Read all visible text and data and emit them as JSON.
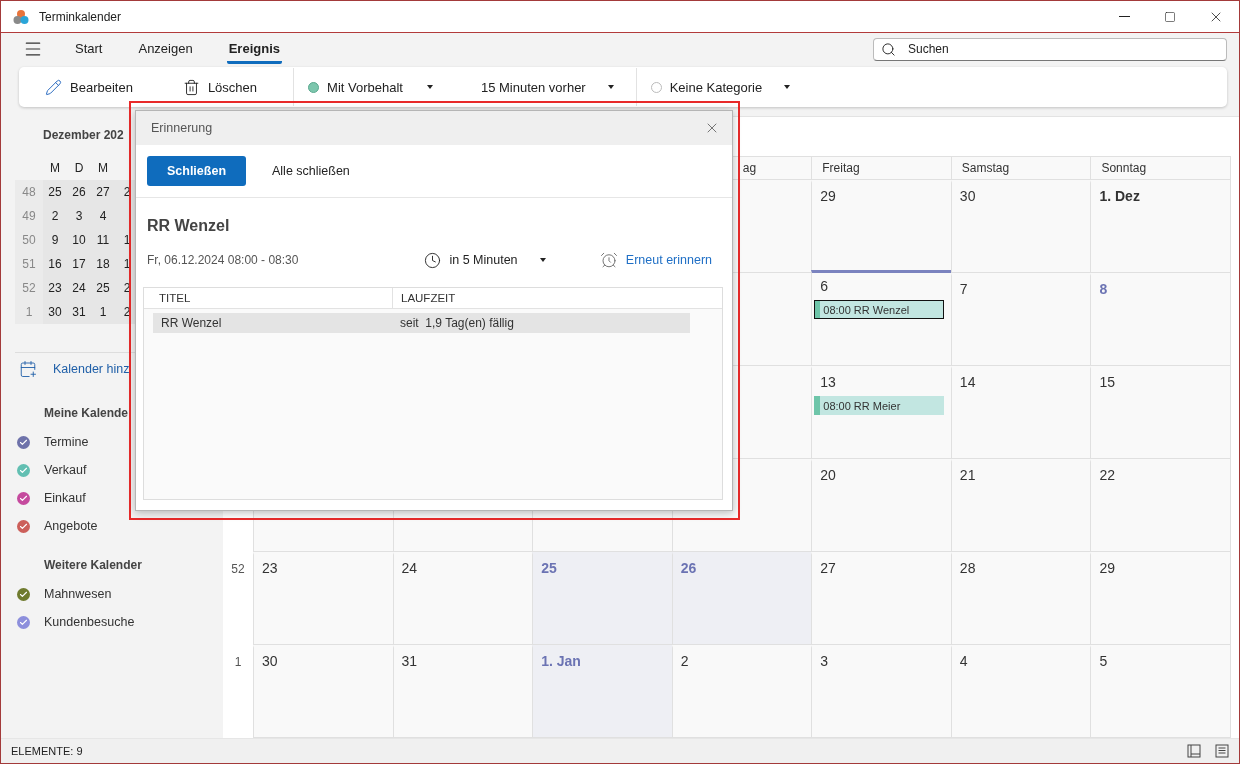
{
  "window": {
    "title": "Terminkalender"
  },
  "menu_tabs": [
    {
      "label": "Start",
      "selected": false
    },
    {
      "label": "Anzeigen",
      "selected": false
    },
    {
      "label": "Ereignis",
      "selected": true
    }
  ],
  "search": {
    "placeholder": "Suchen"
  },
  "toolbar": {
    "edit": "Bearbeiten",
    "delete": "Löschen",
    "availability": "Mit Vorbehalt",
    "reminder": "15 Minuten vorher",
    "category": "Keine Kategorie"
  },
  "mini_calendar": {
    "title": "Dezember 202",
    "weekdays": [
      "M",
      "D",
      "M"
    ],
    "weeks": [
      {
        "number": "48",
        "days": [
          "25",
          "26",
          "27",
          "2"
        ]
      },
      {
        "number": "49",
        "days": [
          "2",
          "3",
          "4"
        ]
      },
      {
        "number": "50",
        "days": [
          "9",
          "10",
          "11",
          "1"
        ]
      },
      {
        "number": "51",
        "days": [
          "16",
          "17",
          "18",
          "1"
        ]
      },
      {
        "number": "52",
        "days": [
          "23",
          "24",
          "25",
          "2"
        ]
      },
      {
        "number": "1",
        "days": [
          "30",
          "31",
          "1",
          "2"
        ]
      }
    ]
  },
  "add_calendar": "Kalender hinz",
  "calendar_groups": [
    {
      "title": "Meine Kalende",
      "calendars": [
        {
          "name": "Termine",
          "color": "#6e72aa",
          "checked": true
        },
        {
          "name": "Verkauf",
          "color": "#62bfb2",
          "checked": true
        },
        {
          "name": "Einkauf",
          "color": "#c54a9e",
          "checked": true
        },
        {
          "name": "Angebote",
          "color": "#cc5f5a",
          "checked": true
        }
      ]
    },
    {
      "title": "Weitere Kalender",
      "calendars": [
        {
          "name": "Mahnwesen",
          "color": "#6f7b2e",
          "checked": true
        },
        {
          "name": "Kundenbesuche",
          "color": "#8d8fdc",
          "checked": true
        }
      ]
    }
  ],
  "calendar": {
    "headers": [
      "ag",
      "Freitag",
      "Samstag",
      "Sonntag"
    ],
    "weeks": [
      {
        "days": [
          {
            "label": "29",
            "kind": "plain",
            "selected": false
          },
          {
            "label": "30",
            "kind": "plain",
            "selected": false
          },
          {
            "label": "1. Dez",
            "kind": "month",
            "selected": false
          }
        ]
      },
      {
        "days": [
          {
            "label": "6",
            "kind": "plain",
            "selected": true,
            "events": [
              {
                "label": "08:00 RR Wenzel",
                "selected": true
              }
            ]
          },
          {
            "label": "7",
            "kind": "plain",
            "selected": false
          },
          {
            "label": "8",
            "kind": "today",
            "selected": false
          }
        ]
      },
      {
        "days": [
          {
            "label": "13",
            "kind": "plain",
            "selected": false,
            "events": [
              {
                "label": "08:00 RR Meier",
                "selected": false
              }
            ]
          },
          {
            "label": "14",
            "kind": "plain",
            "selected": false
          },
          {
            "label": "15",
            "kind": "plain",
            "selected": false
          }
        ]
      },
      {
        "days": [
          {
            "label": "20",
            "kind": "plain",
            "selected": false
          },
          {
            "label": "21",
            "kind": "plain",
            "selected": false
          },
          {
            "label": "22",
            "kind": "plain",
            "selected": false
          }
        ]
      },
      {
        "week": "52",
        "days": [
          {
            "label": "23",
            "kind": "plain",
            "selected": false
          },
          {
            "label": "24",
            "kind": "plain",
            "selected": false
          },
          {
            "label": "25",
            "kind": "holiday",
            "selected": false
          },
          {
            "label": "26",
            "kind": "holiday",
            "selected": false
          },
          {
            "label": "27",
            "kind": "plain",
            "selected": false
          },
          {
            "label": "28",
            "kind": "plain",
            "selected": false
          },
          {
            "label": "29",
            "kind": "plain",
            "selected": false
          }
        ]
      },
      {
        "week": "1",
        "days": [
          {
            "label": "30",
            "kind": "plain",
            "selected": false
          },
          {
            "label": "31",
            "kind": "plain",
            "selected": false
          },
          {
            "label": "1. Jan",
            "kind": "holiday",
            "selected": false
          },
          {
            "label": "2",
            "kind": "plain",
            "selected": false
          },
          {
            "label": "3",
            "kind": "plain",
            "selected": false
          },
          {
            "label": "4",
            "kind": "plain",
            "selected": false
          },
          {
            "label": "5",
            "kind": "plain",
            "selected": false
          }
        ]
      }
    ]
  },
  "dialog": {
    "title": "Erinnerung",
    "primary_button": "Schließen",
    "secondary_button": "Alle schließen",
    "event_title": "RR Wenzel",
    "event_time": "Fr, 06.12.2024 08:00 - 08:30",
    "snooze_choice": "in 5 Minuten",
    "snooze_link": "Erneut erinnern",
    "table": {
      "columns": [
        "TITEL",
        "LAUFZEIT"
      ],
      "rows": [
        {
          "cells": [
            "RR Wenzel",
            "seit  1,9 Tag(en) fällig"
          ],
          "selected": true
        }
      ]
    }
  },
  "status_bar": {
    "text": "ELEMENTE: 9"
  }
}
